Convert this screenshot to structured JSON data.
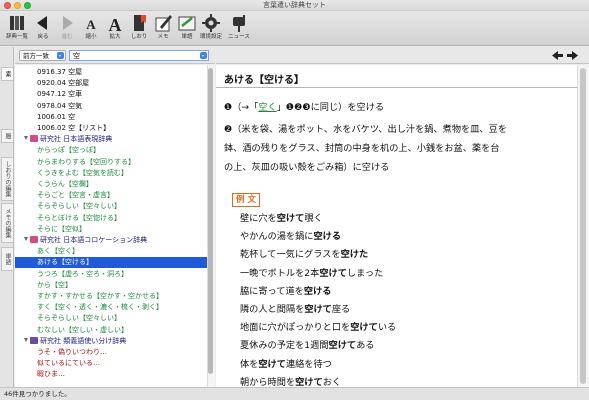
{
  "window": {
    "title": "言葉遣い辞典セット"
  },
  "toolbar": {
    "items": [
      {
        "label": "辞典一覧",
        "icon": "dictionary-list-icon",
        "dim": false
      },
      {
        "label": "戻る",
        "icon": "back-arrow-icon",
        "dim": false
      },
      {
        "label": "進む",
        "icon": "forward-arrow-icon",
        "dim": true
      },
      {
        "label": "縮小",
        "icon": "text-shrink-icon",
        "dim": false
      },
      {
        "label": "拡大",
        "icon": "text-enlarge-icon",
        "dim": false
      },
      {
        "label": "しおり",
        "icon": "bookmark-icon",
        "dim": false
      },
      {
        "label": "メモ",
        "icon": "memo-pen-icon",
        "dim": false
      },
      {
        "label": "単語",
        "icon": "word-card-icon",
        "dim": false
      },
      {
        "label": "環境設定",
        "icon": "gear-icon",
        "dim": false
      },
      {
        "label": "ニュース",
        "icon": "mailbox-icon",
        "dim": false
      }
    ]
  },
  "left_tabs": [
    {
      "label": "索",
      "active": true
    },
    {
      "label": "履",
      "active": false
    },
    {
      "label": "しおりの編集",
      "active": false
    },
    {
      "label": "メモの編集",
      "active": false
    },
    {
      "label": "単語",
      "active": false
    }
  ],
  "search": {
    "mode": "前方一致",
    "query": "空"
  },
  "list": {
    "rows": [
      {
        "text": "0916.37 空屋",
        "kind": "plain"
      },
      {
        "text": "0920.04 空部屋",
        "kind": "plain"
      },
      {
        "text": "0947.12 空車",
        "kind": "plain"
      },
      {
        "text": "0978.04 空気",
        "kind": "plain"
      },
      {
        "text": "1006.01 空",
        "kind": "plain"
      },
      {
        "text": "1006.02 空【リスト】",
        "kind": "plain"
      },
      {
        "text": "研究社 日本語表現辞典",
        "kind": "group",
        "book": "#d64a8a"
      },
      {
        "text": "からっぽ【空っぽ】",
        "kind": "green"
      },
      {
        "text": "からまわりする【空回りする】",
        "kind": "green"
      },
      {
        "text": "くうきをよむ【空気を読む】",
        "kind": "green"
      },
      {
        "text": "くうらん【空欄】",
        "kind": "green"
      },
      {
        "text": "そらごと【空言・虚言】",
        "kind": "green"
      },
      {
        "text": "そらぞらしい【空々しい】",
        "kind": "green"
      },
      {
        "text": "そらとぼける【空惚ける】",
        "kind": "green"
      },
      {
        "text": "そらに【空似】",
        "kind": "green"
      },
      {
        "text": "研究社 日本語コロケーション辞典",
        "kind": "group",
        "book": "#d64a8a"
      },
      {
        "text": "あく【空く】",
        "kind": "green"
      },
      {
        "text": "あける【空ける】",
        "kind": "sel"
      },
      {
        "text": "うつろ【虚ろ・空ろ・洞ろ】",
        "kind": "green"
      },
      {
        "text": "から【空】",
        "kind": "green"
      },
      {
        "text": "すかす・すかせる【空かす・空かせる】",
        "kind": "green"
      },
      {
        "text": "すく【空く・透く・漉く・梳く・剥く】",
        "kind": "green"
      },
      {
        "text": "そらぞらしい【空々しい】",
        "kind": "green"
      },
      {
        "text": "むなしい【空しい・虚しい】",
        "kind": "green"
      },
      {
        "text": "研究社 類義語使い分け辞典",
        "kind": "group",
        "book": "#6b4aa8"
      },
      {
        "text": "うそ・偽りいつわり…",
        "kind": "red"
      },
      {
        "text": "似ているにている…",
        "kind": "red"
      },
      {
        "text": "暇ひま…",
        "kind": "red"
      }
    ]
  },
  "status": {
    "text": "46件見つかりました。"
  },
  "entry": {
    "headword": "あける【空ける】",
    "def1_pre": "❶（→「",
    "def1_link": "空く",
    "def1_post": "」❶❷❸に同じ）を空ける",
    "def2_line1": "❷（米を袋、湯をポット、水をバケツ、出し汁を鍋、煮物を皿、豆を",
    "def2_line2": "鉢、酒の残りをグラス、封筒の中身を机の上、小銭をお盆、薬を台",
    "def2_line3": "の上、灰皿の吸い殻をごみ箱）に空ける",
    "examples_label": "例 文",
    "examples": [
      {
        "pre": "壁に穴を",
        "bold": "空けて",
        "post": "覗く"
      },
      {
        "pre": "やかんの湯を鍋に",
        "bold": "空ける",
        "post": ""
      },
      {
        "pre": "乾杯して一気にグラスを",
        "bold": "空けた",
        "post": ""
      },
      {
        "pre": "一晩でボトルを2本",
        "bold": "空けて",
        "post": "しまった"
      },
      {
        "pre": "脇に寄って道を",
        "bold": "空ける",
        "post": ""
      },
      {
        "pre": "隣の人と間隔を",
        "bold": "空けて",
        "post": "座る"
      },
      {
        "pre": "地面に穴がぽっかりと口を",
        "bold": "空けて",
        "post": "いる"
      },
      {
        "pre": "夏休みの予定を1週間",
        "bold": "空けて",
        "post": "ある"
      },
      {
        "pre": "体を",
        "bold": "空けて",
        "post": "連絡を待つ"
      },
      {
        "pre": "朝から時間を",
        "bold": "空けて",
        "post": "おく"
      }
    ]
  },
  "colors": {
    "selection": "#1f5bd6",
    "link_green": "#1a8a3a",
    "group_blue": "#1a1a8a",
    "example_orange": "#e06a1c"
  }
}
